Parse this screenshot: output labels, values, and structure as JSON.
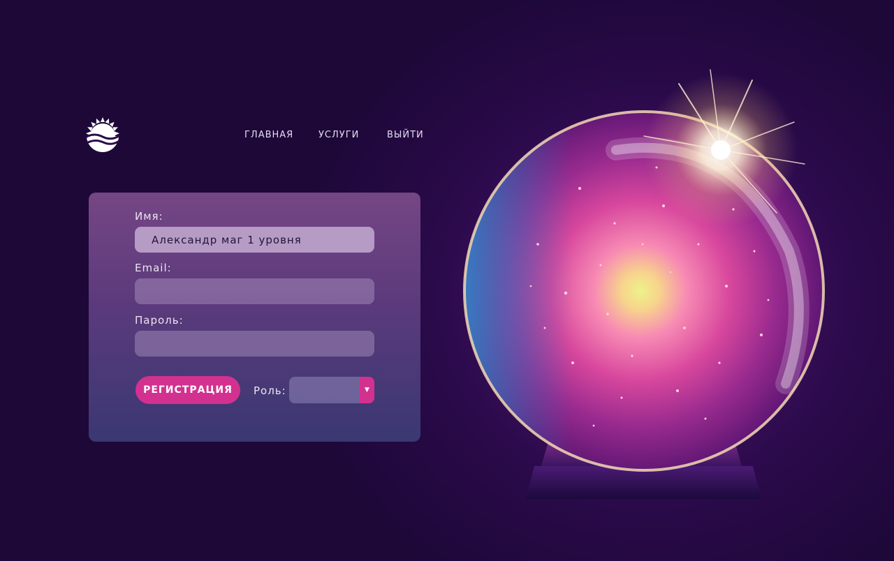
{
  "header": {
    "logo_icon": "sun-over-waves-logo-icon",
    "nav": [
      {
        "label": "ГЛАВНАЯ"
      },
      {
        "label": "УСЛУГИ"
      },
      {
        "label": "ВЫЙТИ"
      }
    ]
  },
  "form": {
    "name_label": "Имя:",
    "name_value": "Александр маг 1 уровня",
    "email_label": "Email:",
    "email_value": "",
    "password_label": "Пароль:",
    "password_value": "",
    "register_label": "РЕГИСТРАЦИЯ",
    "role_label": "Роль:",
    "role_value": "",
    "role_arrow_icon": "caret-down-icon"
  },
  "illustration": {
    "name": "crystal-ball"
  },
  "colors": {
    "background": "#2c0a4c",
    "card_top": "#754684",
    "card_bottom": "#3a3872",
    "accent": "#d3318f",
    "input_filled": "#b69cc4"
  }
}
